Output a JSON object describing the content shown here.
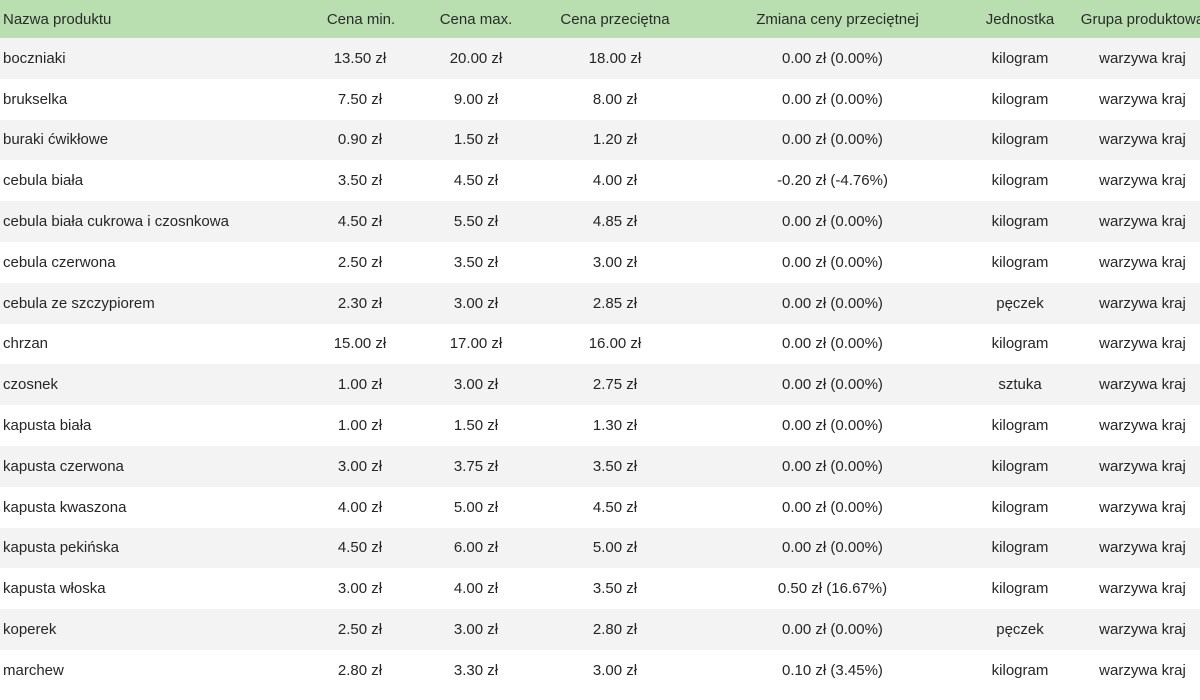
{
  "table": {
    "headers": {
      "name": "Nazwa produktu",
      "min": "Cena min.",
      "max": "Cena max.",
      "avg": "Cena przeciętna",
      "change": "Zmiana ceny przeciętnej",
      "unit": "Jednostka",
      "group": "Grupa produktowa"
    },
    "rows": [
      {
        "name": "boczniaki",
        "min": "13.50 zł",
        "max": "20.00 zł",
        "avg": "18.00 zł",
        "change": "0.00 zł (0.00%)",
        "unit": "kilogram",
        "group": "warzywa kraj"
      },
      {
        "name": "brukselka",
        "min": "7.50 zł",
        "max": "9.00 zł",
        "avg": "8.00 zł",
        "change": "0.00 zł (0.00%)",
        "unit": "kilogram",
        "group": "warzywa kraj"
      },
      {
        "name": "buraki ćwikłowe",
        "min": "0.90 zł",
        "max": "1.50 zł",
        "avg": "1.20 zł",
        "change": "0.00 zł (0.00%)",
        "unit": "kilogram",
        "group": "warzywa kraj"
      },
      {
        "name": "cebula biała",
        "min": "3.50 zł",
        "max": "4.50 zł",
        "avg": "4.00 zł",
        "change": "-0.20 zł (-4.76%)",
        "unit": "kilogram",
        "group": "warzywa kraj"
      },
      {
        "name": "cebula biała cukrowa i czosnkowa",
        "min": "4.50 zł",
        "max": "5.50 zł",
        "avg": "4.85 zł",
        "change": "0.00 zł (0.00%)",
        "unit": "kilogram",
        "group": "warzywa kraj"
      },
      {
        "name": "cebula czerwona",
        "min": "2.50 zł",
        "max": "3.50 zł",
        "avg": "3.00 zł",
        "change": "0.00 zł (0.00%)",
        "unit": "kilogram",
        "group": "warzywa kraj"
      },
      {
        "name": "cebula ze szczypiorem",
        "min": "2.30 zł",
        "max": "3.00 zł",
        "avg": "2.85 zł",
        "change": "0.00 zł (0.00%)",
        "unit": "pęczek",
        "group": "warzywa kraj"
      },
      {
        "name": "chrzan",
        "min": "15.00 zł",
        "max": "17.00 zł",
        "avg": "16.00 zł",
        "change": "0.00 zł (0.00%)",
        "unit": "kilogram",
        "group": "warzywa kraj"
      },
      {
        "name": "czosnek",
        "min": "1.00 zł",
        "max": "3.00 zł",
        "avg": "2.75 zł",
        "change": "0.00 zł (0.00%)",
        "unit": "sztuka",
        "group": "warzywa kraj"
      },
      {
        "name": "kapusta biała",
        "min": "1.00 zł",
        "max": "1.50 zł",
        "avg": "1.30 zł",
        "change": "0.00 zł (0.00%)",
        "unit": "kilogram",
        "group": "warzywa kraj"
      },
      {
        "name": "kapusta czerwona",
        "min": "3.00 zł",
        "max": "3.75 zł",
        "avg": "3.50 zł",
        "change": "0.00 zł (0.00%)",
        "unit": "kilogram",
        "group": "warzywa kraj"
      },
      {
        "name": "kapusta kwaszona",
        "min": "4.00 zł",
        "max": "5.00 zł",
        "avg": "4.50 zł",
        "change": "0.00 zł (0.00%)",
        "unit": "kilogram",
        "group": "warzywa kraj"
      },
      {
        "name": "kapusta pekińska",
        "min": "4.50 zł",
        "max": "6.00 zł",
        "avg": "5.00 zł",
        "change": "0.00 zł (0.00%)",
        "unit": "kilogram",
        "group": "warzywa kraj"
      },
      {
        "name": "kapusta włoska",
        "min": "3.00 zł",
        "max": "4.00 zł",
        "avg": "3.50 zł",
        "change": "0.50 zł (16.67%)",
        "unit": "kilogram",
        "group": "warzywa kraj"
      },
      {
        "name": "koperek",
        "min": "2.50 zł",
        "max": "3.00 zł",
        "avg": "2.80 zł",
        "change": "0.00 zł (0.00%)",
        "unit": "pęczek",
        "group": "warzywa kraj"
      },
      {
        "name": "marchew",
        "min": "2.80 zł",
        "max": "3.30 zł",
        "avg": "3.00 zł",
        "change": "0.10 zł (3.45%)",
        "unit": "kilogram",
        "group": "warzywa kraj"
      }
    ]
  },
  "colors": {
    "header_bg": "#b9dfb0",
    "row_odd_bg": "#f3f3f3",
    "row_even_bg": "#ffffff"
  }
}
